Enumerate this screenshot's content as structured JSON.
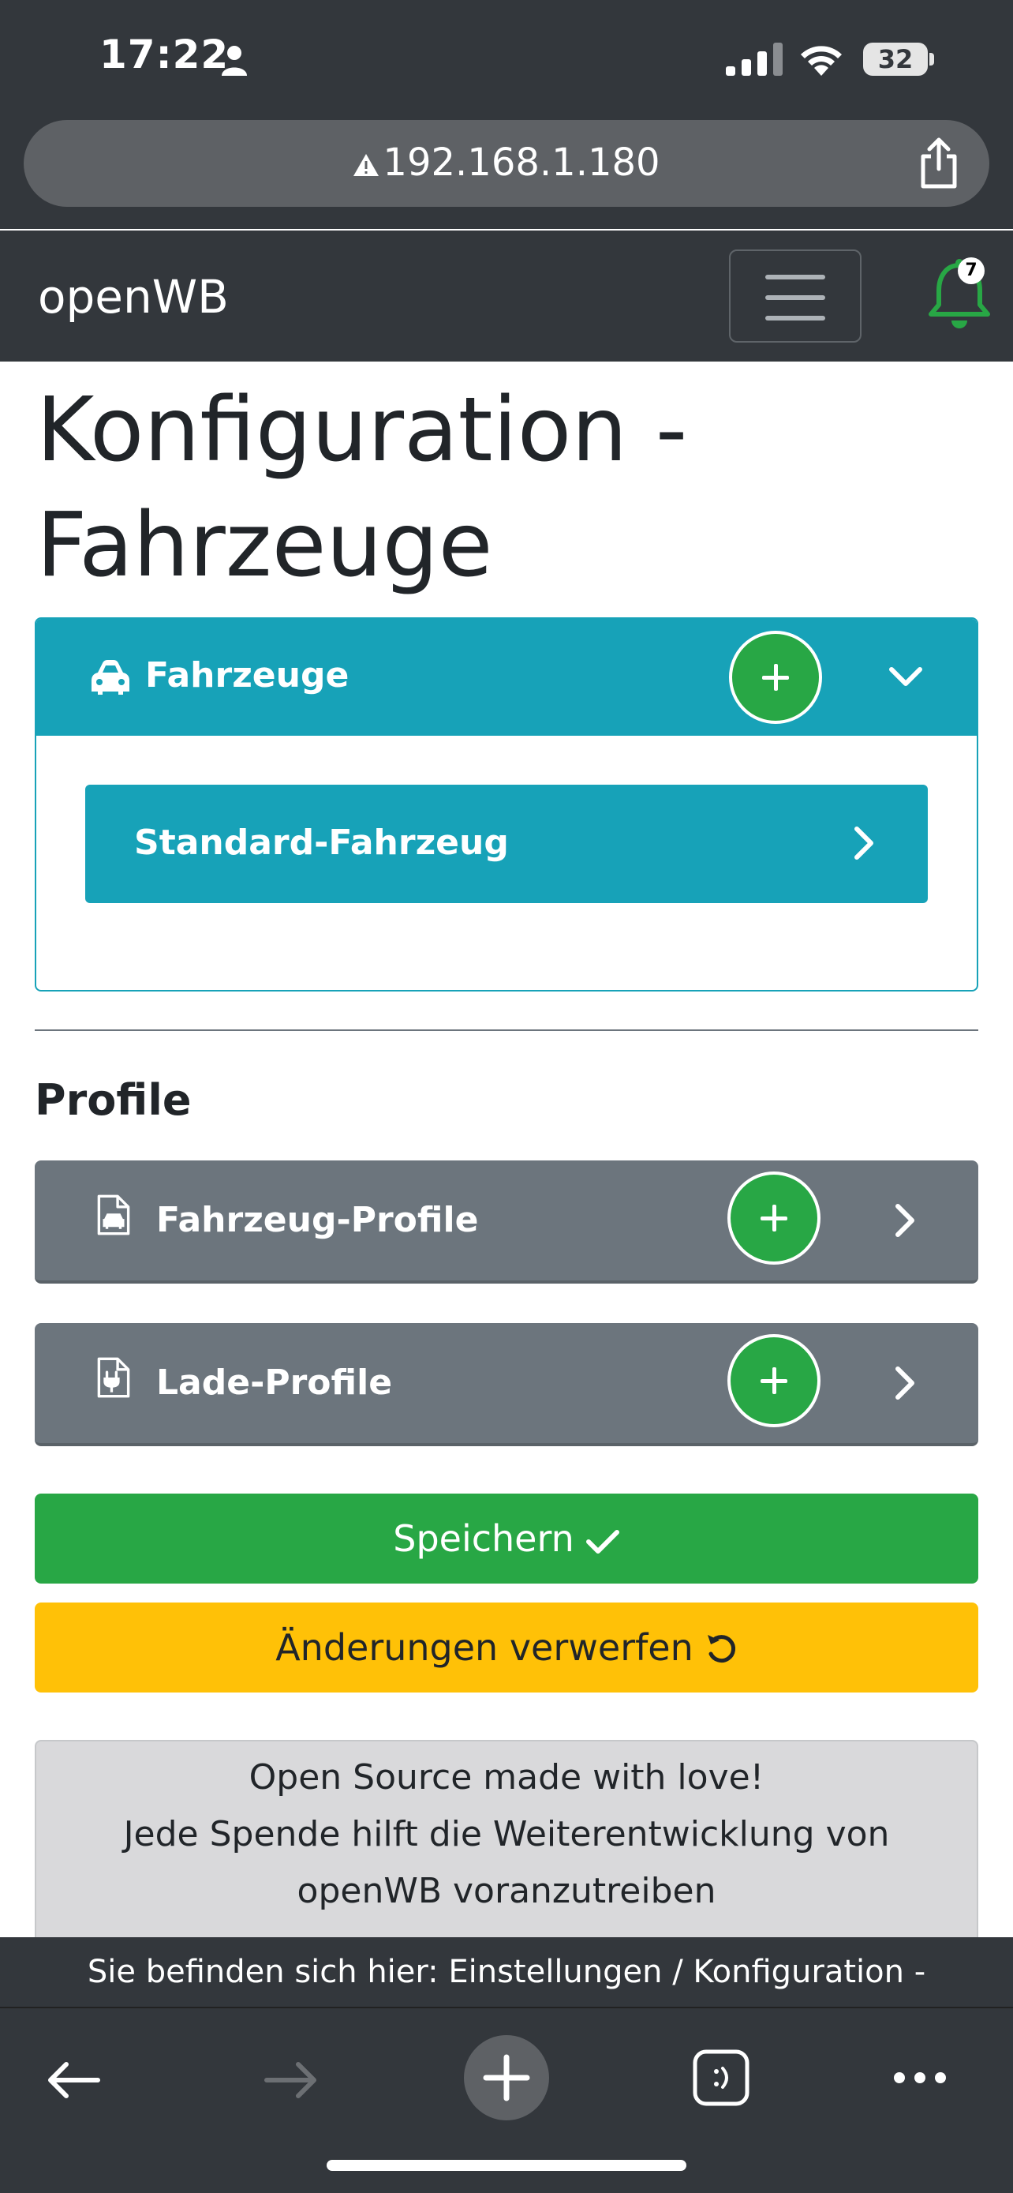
{
  "status_bar": {
    "time": "17:22",
    "battery": "32"
  },
  "browser": {
    "url": "192.168.1.180"
  },
  "navbar": {
    "brand": "openWB",
    "notification_count": "7"
  },
  "page": {
    "title": "Konfiguration - Fahrzeuge"
  },
  "vehicles_card": {
    "header": "Fahrzeuge",
    "items": [
      {
        "label": "Standard-Fahrzeug"
      }
    ]
  },
  "profiles": {
    "section_title": "Profile",
    "cards": [
      {
        "label": "Fahrzeug-Profile"
      },
      {
        "label": "Lade-Profile"
      }
    ]
  },
  "buttons": {
    "save": "Speichern",
    "discard": "Änderungen verwerfen"
  },
  "donate": {
    "line1": "Open Source made with love!",
    "line2": "Jede Spende hilft die Weiterentwicklung von",
    "line3": "openWB voranzutreiben"
  },
  "breadcrumb": "Sie befinden sich hier: Einstellungen / Konfiguration -",
  "colors": {
    "info": "#17a2b8",
    "secondary": "#6c757d",
    "success": "#28a745",
    "warning": "#ffc107",
    "dark": "#33373c"
  }
}
